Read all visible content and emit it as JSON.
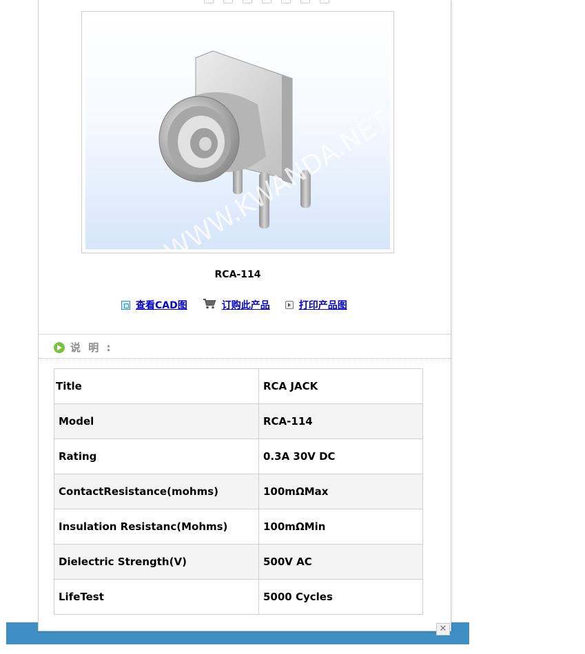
{
  "product": {
    "name": "RCA-114",
    "watermark": "WWW.KWANDA.NET"
  },
  "actions": [
    {
      "label": "查看CAD图",
      "icon": "cad-icon"
    },
    {
      "label": "订购此产品",
      "icon": "cart-icon"
    },
    {
      "label": "打印产品图",
      "icon": "print-icon"
    }
  ],
  "description": {
    "heading": "说 明 :"
  },
  "specs": [
    {
      "key": "Title",
      "value": "RCA JACK"
    },
    {
      "key": "Model",
      "value": "RCA-114"
    },
    {
      "key": "Rating",
      "value": "0.3A 30V DC"
    },
    {
      "key": "ContactResistance(mohms)",
      "value": "100mΩMax"
    },
    {
      "key": "Insulation Resistanc(Mohms)",
      "value": "100mΩMin"
    },
    {
      "key": "Dielectric Strength(V)",
      "value": "500V AC"
    },
    {
      "key": "LifeTest",
      "value": "5000 Cycles"
    }
  ],
  "colors": {
    "link": "#0000cc",
    "bottom_bar": "#3f8fc4",
    "accent_green": "#7cc041"
  },
  "close_label": "✕"
}
